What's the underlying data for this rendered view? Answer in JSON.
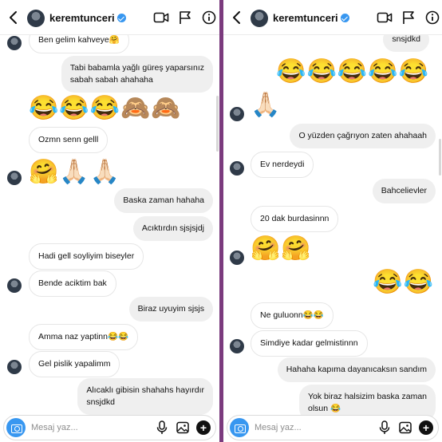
{
  "username": "keremtunceri",
  "composer": {
    "placeholder": "Mesaj yaz..."
  },
  "icons": {
    "back": "chevron-left-icon",
    "video": "video-camera-icon",
    "flag": "flag-icon",
    "info": "info-icon",
    "camera": "camera-icon",
    "mic": "microphone-icon",
    "gallery": "image-icon",
    "add": "plus-icon"
  },
  "colors": {
    "divider": "#7b3b7e",
    "verified": "#3897f0",
    "camera_button": "#3897f0",
    "sent_bubble": "#efefef"
  },
  "left_panel": {
    "messages": [
      {
        "side": "received",
        "text": "Ben gelim kahveye🤗"
      },
      {
        "side": "sent",
        "text": "Tabi babamla yağlı güreş yaparsınız\nsabah sabah ahahaha"
      },
      {
        "side": "sent",
        "text": "😂😂😂🙈🙈",
        "emoji": true
      },
      {
        "side": "received",
        "text": "Ozmn senn gelll"
      },
      {
        "side": "received",
        "text": "🤗🙏🏻🙏🏻",
        "emoji": true
      },
      {
        "side": "sent",
        "text": "Baska zaman hahaha"
      },
      {
        "side": "sent",
        "text": "Acıktırdın sjsjsjdj"
      },
      {
        "side": "received",
        "text": "Hadi gell soyliyim biseyler"
      },
      {
        "side": "received",
        "text": "Bende aciktim bak"
      },
      {
        "side": "sent",
        "text": "Biraz uyuyim sjsjs"
      },
      {
        "side": "received",
        "text": "Amma naz yaptinn😂😂"
      },
      {
        "side": "received",
        "text": "Gel pislik yapalimm"
      },
      {
        "side": "sent",
        "text": "Alıcaklı gibisin shahahs hayırdır\nsnsjdkd"
      }
    ]
  },
  "right_panel": {
    "messages": [
      {
        "side": "sent",
        "text": "snsjdkd"
      },
      {
        "side": "sent",
        "text": "😂😂😂😂😂",
        "emoji": true
      },
      {
        "side": "received",
        "text": "🙏🏻",
        "emoji": true
      },
      {
        "side": "sent",
        "text": "O yüzden çağrıyon zaten ahahaah"
      },
      {
        "side": "received",
        "text": "Ev nerdeydi"
      },
      {
        "side": "sent",
        "text": "Bahcelievler"
      },
      {
        "side": "received",
        "text": "20 dak burdasinnn"
      },
      {
        "side": "received",
        "text": "🤗🤗",
        "emoji": true
      },
      {
        "side": "sent",
        "text": "😂😂",
        "emoji": true
      },
      {
        "side": "received",
        "text": "Ne guluonn😂😂"
      },
      {
        "side": "received",
        "text": "Simdiye kadar gelmistinnn"
      },
      {
        "side": "sent",
        "text": "Hahaha kapıma dayanıcaksın sandım"
      },
      {
        "side": "sent",
        "text": "Yok biraz halsizim baska zaman\nolsun 😂"
      }
    ]
  }
}
